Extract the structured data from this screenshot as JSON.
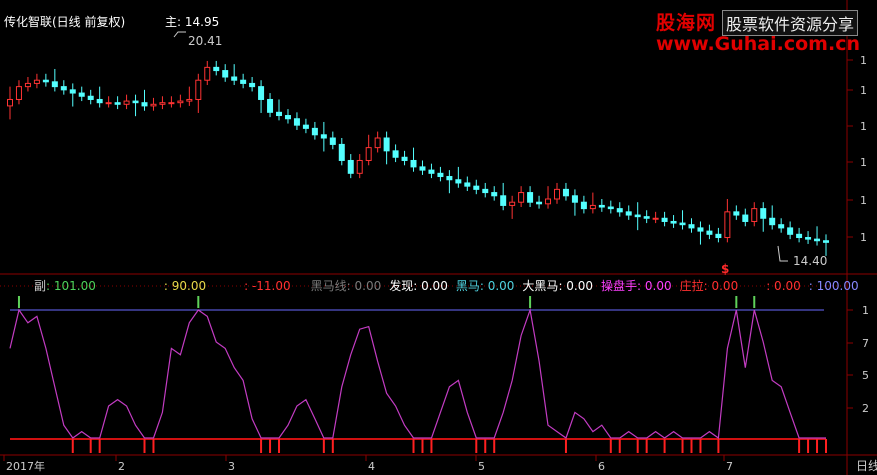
{
  "title": "传化智联(日线 前复权)",
  "main_label": "主",
  "main_value": ": 14.95",
  "price_high": "20.41",
  "price_low": "14.40",
  "signal_mark": "$",
  "logo": {
    "cn": "股海网",
    "slogan": "股票软件资源分享",
    "url": "www.Guhai.com.cn"
  },
  "sub_header": [
    {
      "label": "副",
      "value": ": 101.00",
      "label_color": "#cccccc",
      "value_color": "#4fd25a"
    },
    {
      "label": "",
      "value": ": 90.00",
      "label_color": "#cccccc",
      "value_color": "#e8d94a"
    },
    {
      "label": "",
      "value": ": -11.00",
      "label_color": "#cccccc",
      "value_color": "#ff3030"
    },
    {
      "label": "黑马线",
      "value": ": 0.00",
      "label_color": "#7a7a7a",
      "value_color": "#7a7a7a"
    },
    {
      "label": "发现",
      "value": ": 0.00",
      "label_color": "#ffffff",
      "value_color": "#ffffff"
    },
    {
      "label": "黑马",
      "value": ": 0.00",
      "label_color": "#4fd2e0",
      "value_color": "#4fd2e0"
    },
    {
      "label": "大黑马",
      "value": ": 0.00",
      "label_color": "#ffffff",
      "value_color": "#ffffff"
    },
    {
      "label": "操盘手",
      "value": ": 0.00",
      "label_color": "#ff40ff",
      "value_color": "#ff40ff"
    },
    {
      "label": "庄拉",
      "value": ": 0.00",
      "label_color": "#ff3030",
      "value_color": "#ff3030"
    },
    {
      "label": "",
      "value": ": 0.00",
      "label_color": "#ff3030",
      "value_color": "#ff3030"
    },
    {
      "label": "",
      "value": ": 100.00",
      "label_color": "#8888ff",
      "value_color": "#8888ff"
    }
  ],
  "axis": {
    "main_ticks": [
      "1",
      "1",
      "1",
      "1",
      "1",
      "1"
    ],
    "sub_ticks": [
      "1",
      "7",
      "5",
      "2"
    ]
  },
  "time_axis": [
    "2017年",
    "2",
    "3",
    "4",
    "5",
    "6",
    "7"
  ],
  "day_label": "日线",
  "colors": {
    "up": "#ff3333",
    "down": "#54ffff",
    "osc": "#c33cc3",
    "line100": "#6a6aff",
    "grid": "#8b0000"
  },
  "chart_data": {
    "type": "candlestick",
    "close": [
      14.2,
      14.6,
      14.7,
      14.8,
      14.75,
      14.6,
      14.5,
      14.4,
      14.3,
      14.2,
      14.1,
      14.1,
      14.05,
      14.15,
      14.1,
      14.0,
      14.05,
      14.1,
      14.1,
      14.15,
      14.2,
      14.8,
      15.2,
      15.1,
      14.9,
      14.8,
      14.7,
      14.6,
      14.2,
      13.8,
      13.7,
      13.6,
      13.4,
      13.3,
      13.1,
      13.0,
      12.8,
      12.3,
      11.9,
      12.3,
      12.7,
      13.0,
      12.6,
      12.4,
      12.3,
      12.1,
      12.0,
      11.9,
      11.8,
      11.7,
      11.6,
      11.5,
      11.4,
      11.3,
      11.2,
      10.9,
      11.0,
      11.3,
      11.0,
      10.95,
      11.1,
      11.4,
      11.2,
      11.0,
      10.8,
      10.9,
      10.85,
      10.8,
      10.7,
      10.6,
      10.55,
      10.5,
      10.5,
      10.4,
      10.35,
      10.3,
      10.2,
      10.1,
      10.0,
      9.9,
      10.7,
      10.6,
      10.4,
      10.8,
      10.5,
      10.3,
      10.2,
      10.0,
      9.9,
      9.85,
      9.8,
      9.75
    ],
    "x": [
      "2017年",
      "2",
      "3",
      "4",
      "5",
      "6",
      "7"
    ],
    "oscillator": [
      70,
      100,
      90,
      95,
      70,
      40,
      10,
      0,
      5,
      0,
      0,
      25,
      30,
      25,
      10,
      0,
      0,
      20,
      70,
      65,
      90,
      100,
      95,
      75,
      70,
      55,
      45,
      15,
      0,
      0,
      0,
      10,
      25,
      30,
      15,
      0,
      0,
      40,
      65,
      85,
      87,
      60,
      35,
      25,
      10,
      0,
      0,
      0,
      20,
      40,
      45,
      20,
      0,
      0,
      0,
      20,
      45,
      80,
      100,
      60,
      10,
      5,
      0,
      20,
      15,
      5,
      10,
      0,
      0,
      5,
      0,
      0,
      5,
      0,
      5,
      0,
      0,
      0,
      5,
      0,
      70,
      100,
      55,
      100,
      75,
      45,
      40,
      20,
      0,
      0,
      0,
      0
    ],
    "oscillator_ylim": [
      -10,
      110
    ],
    "price_ylim": [
      9.2,
      16.8
    ]
  }
}
